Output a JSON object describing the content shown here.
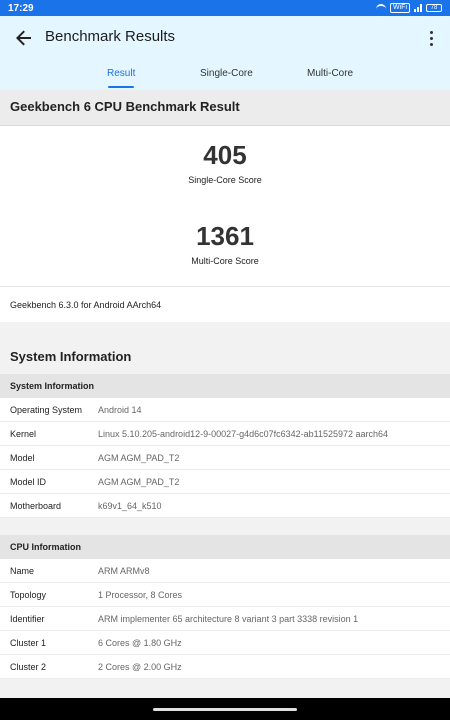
{
  "status_bar": {
    "time": "17:29",
    "wifi_label": "WiFi",
    "battery": "78"
  },
  "app_bar": {
    "title": "Benchmark Results"
  },
  "tabs": [
    {
      "label": "Result",
      "active": true
    },
    {
      "label": "Single-Core",
      "active": false
    },
    {
      "label": "Multi-Core",
      "active": false
    }
  ],
  "result_card": {
    "header": "Geekbench 6 CPU Benchmark Result",
    "single_core_score": "405",
    "single_core_label": "Single-Core Score",
    "multi_core_score": "1361",
    "multi_core_label": "Multi-Core Score",
    "version": "Geekbench 6.3.0 for Android AArch64"
  },
  "system_section": {
    "title": "System Information",
    "table_header": "System Information",
    "rows": [
      {
        "key": "Operating System",
        "value": "Android 14"
      },
      {
        "key": "Kernel",
        "value": "Linux 5.10.205-android12-9-00027-g4d6c07fc6342-ab11525972 aarch64"
      },
      {
        "key": "Model",
        "value": "AGM AGM_PAD_T2"
      },
      {
        "key": "Model ID",
        "value": "AGM AGM_PAD_T2"
      },
      {
        "key": "Motherboard",
        "value": "k69v1_64_k510"
      }
    ]
  },
  "cpu_section": {
    "table_header": "CPU Information",
    "rows": [
      {
        "key": "Name",
        "value": "ARM ARMv8"
      },
      {
        "key": "Topology",
        "value": "1 Processor, 8 Cores"
      },
      {
        "key": "Identifier",
        "value": "ARM implementer 65 architecture 8 variant 3 part 3338 revision 1"
      },
      {
        "key": "Cluster 1",
        "value": "6 Cores @ 1.80 GHz"
      },
      {
        "key": "Cluster 2",
        "value": "2 Cores @ 2.00 GHz"
      }
    ]
  },
  "icons": {
    "back": "arrow-left-icon",
    "more": "more-vertical-icon"
  },
  "colors": {
    "accent": "#1a73e8",
    "app_bar_bg": "#e4f6ff"
  }
}
